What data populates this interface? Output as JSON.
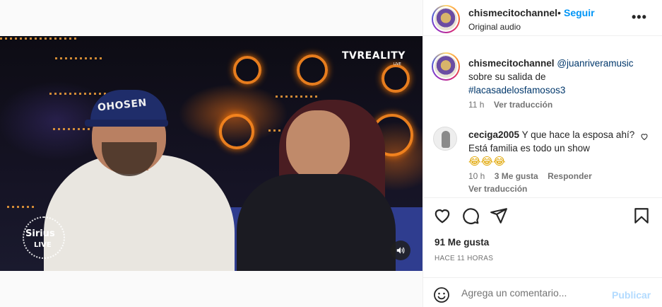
{
  "video": {
    "watermark_tv": "TVREALITY",
    "watermark_tv_sub": "LIVE",
    "cap_text": "OHOSEN",
    "sirius": "Sirius",
    "sirius_live": "LIVE",
    "audio_icon": "speaker-icon"
  },
  "header": {
    "username": "chismecitochannel",
    "separator": "•",
    "follow": "Seguir",
    "audio": "Original audio",
    "more_icon": "more-options-icon"
  },
  "caption": {
    "username": "chismecitochannel",
    "mention": "@juanriveramusic",
    "text": "sobre su salida de",
    "hashtag": "#lacasadelosfamosos3",
    "time": "11 h",
    "translate": "Ver traducción"
  },
  "comment": {
    "username": "ceciga2005",
    "text": "Y que hace la esposa ahí? Está familia es todo un show",
    "emojis": "😂😂😂",
    "time": "10 h",
    "likes": "3 Me gusta",
    "reply": "Responder",
    "translate": "Ver traducción"
  },
  "post": {
    "likes": "91 Me gusta",
    "timestamp": "HACE 11 HORAS"
  },
  "comment_bar": {
    "placeholder": "Agrega un comentario...",
    "post": "Publicar"
  }
}
